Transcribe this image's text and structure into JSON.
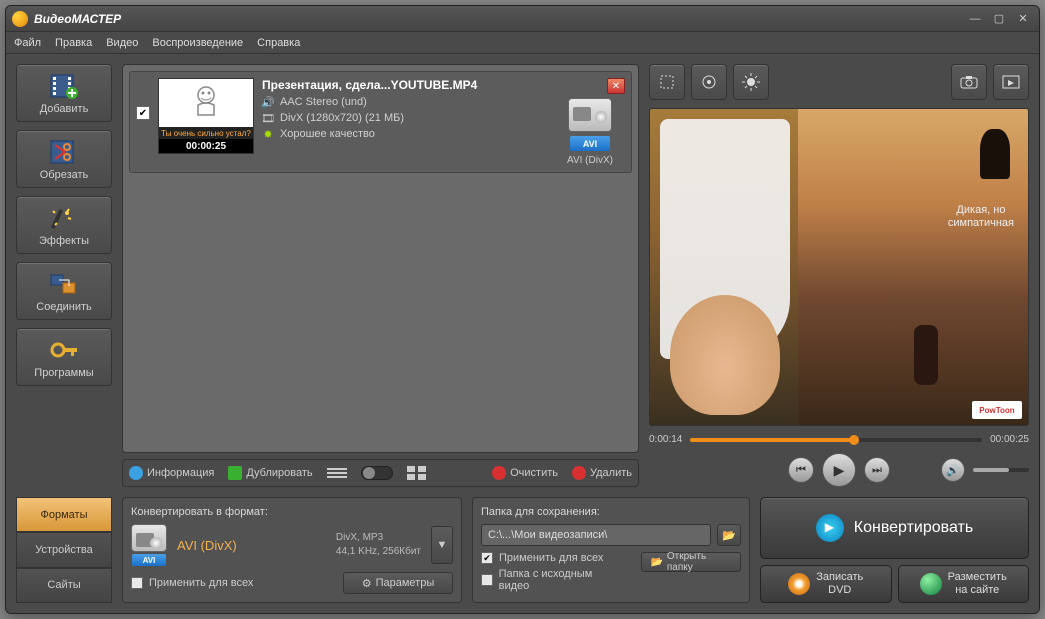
{
  "app": {
    "title": "ВидеоМАСТЕР"
  },
  "menu": [
    "Файл",
    "Правка",
    "Видео",
    "Воспроизведение",
    "Справка"
  ],
  "sidebar": [
    {
      "label": "Добавить",
      "name": "add-button"
    },
    {
      "label": "Обрезать",
      "name": "trim-button"
    },
    {
      "label": "Эффекты",
      "name": "effects-button"
    },
    {
      "label": "Соединить",
      "name": "join-button"
    },
    {
      "label": "Программы",
      "name": "programs-button"
    }
  ],
  "file": {
    "name": "Презентация, сдела...YOUTUBE.MP4",
    "audio": "AAC Stereo (und)",
    "video": "DivX (1280x720) (21 МБ)",
    "quality": "Хорошее качество",
    "thumb_caption": "Ты очень сильно устал?",
    "duration": "00:00:25",
    "out_format": "AVI",
    "out_codec": "AVI (DivX)"
  },
  "list_toolbar": {
    "info": "Информация",
    "dup": "Дублировать",
    "clear": "Очистить",
    "delete": "Удалить"
  },
  "preview": {
    "overlay_l1": "Дикая, но",
    "overlay_l2": "симпатичная",
    "logo": "PowToon",
    "time_cur": "0:00:14",
    "time_total": "00:00:25",
    "progress_pct": 56
  },
  "tabs": [
    "Форматы",
    "Устройства",
    "Сайты"
  ],
  "format_panel": {
    "title": "Конвертировать в формат:",
    "name": "AVI (DivX)",
    "codec_line": "DivX, MP3",
    "params_line": "44,1 KHz, 256Кбит",
    "apply_all": "Применить для всех",
    "params_btn": "Параметры"
  },
  "save_panel": {
    "title": "Папка для сохранения:",
    "path": "С:\\...\\Мои видеозаписи\\",
    "apply_all": "Применить для всех",
    "source_folder": "Папка с исходным видео",
    "open": "Открыть папку"
  },
  "actions": {
    "convert": "Конвертировать",
    "dvd_l1": "Записать",
    "dvd_l2": "DVD",
    "site_l1": "Разместить",
    "site_l2": "на сайте"
  }
}
